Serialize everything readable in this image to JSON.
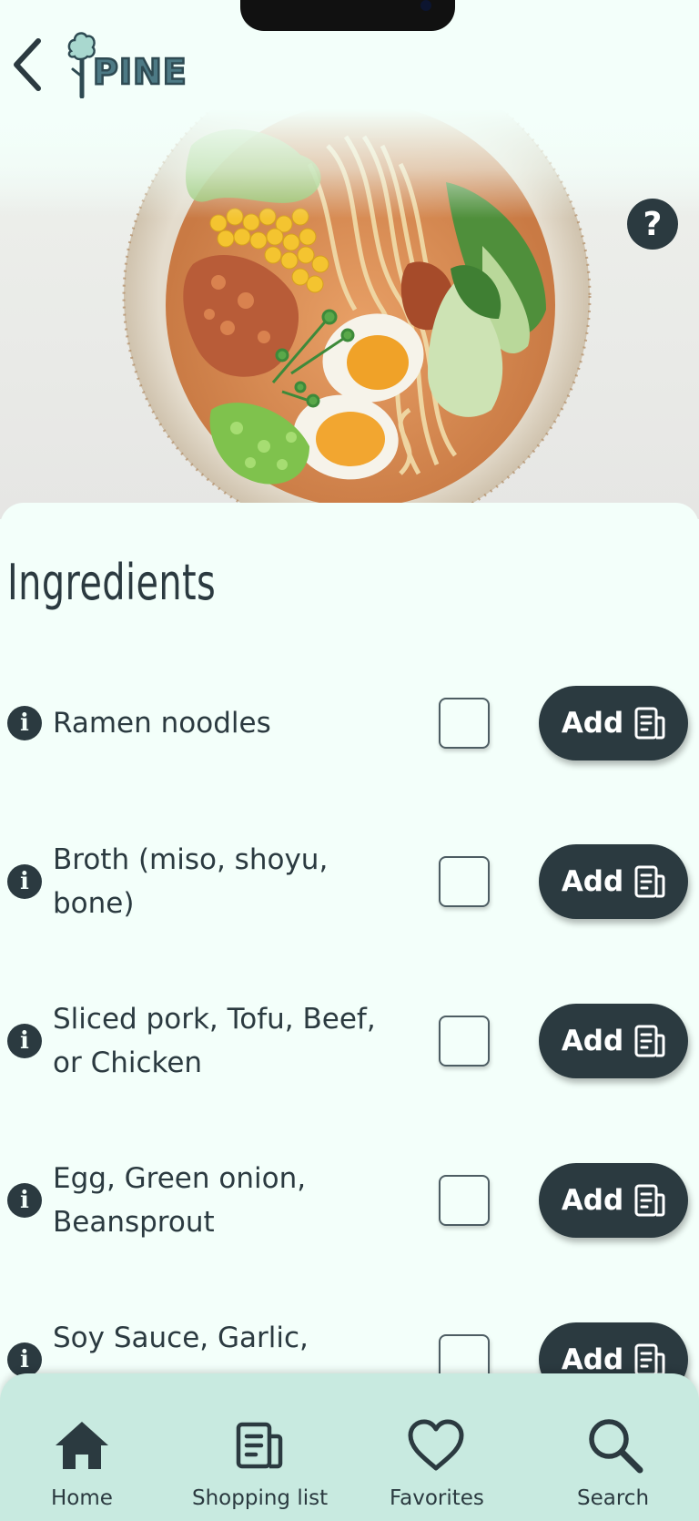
{
  "header": {
    "back_icon": "chevron-left-icon",
    "logo_text": "PINE",
    "logo_icon": "tree-icon"
  },
  "hero": {
    "image": "ramen-bowl-photo",
    "help_symbol": "?"
  },
  "ingredients": {
    "title": "Ingredients",
    "items": [
      {
        "name": "Ramen noodles",
        "add_label": "Add"
      },
      {
        "name": "Broth (miso, shoyu, bone)",
        "add_label": "Add"
      },
      {
        "name": "Sliced pork, Tofu, Beef, or Chicken",
        "add_label": "Add"
      },
      {
        "name": "Egg, Green onion, Beansprout",
        "add_label": "Add"
      },
      {
        "name": "Soy Sauce, Garlic,",
        "add_label": "Add"
      }
    ]
  },
  "bottom_nav": {
    "items": [
      {
        "label": "Home",
        "icon": "home-icon"
      },
      {
        "label": "Shopping list",
        "icon": "shopping-list-icon"
      },
      {
        "label": "Favorites",
        "icon": "heart-icon"
      },
      {
        "label": "Search",
        "icon": "search-icon"
      }
    ]
  },
  "colors": {
    "background": "#f3fffa",
    "primary_dark": "#2b3a40",
    "nav_background": "#c8eae0",
    "logo_teal": "#4d7a85"
  }
}
